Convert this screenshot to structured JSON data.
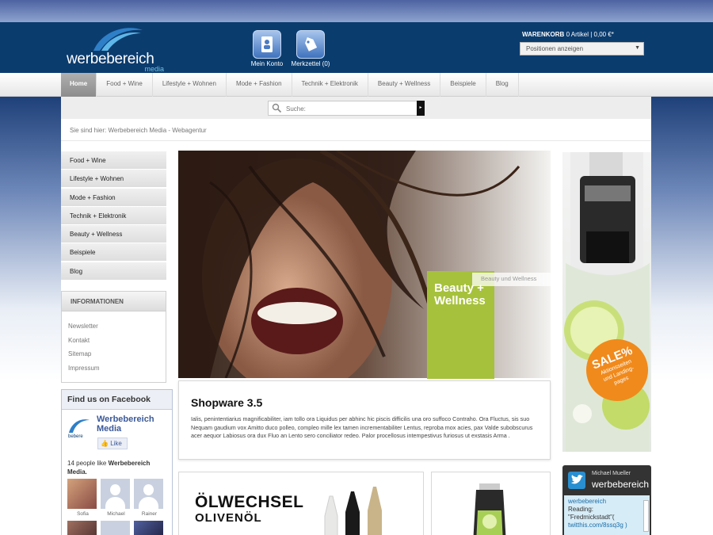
{
  "header": {
    "logo_text": "werbebereich",
    "logo_sub": "media",
    "account_label": "Mein Konto",
    "wishlist_label": "Merkzettel (0)",
    "cart_title": "WARENKORB",
    "cart_summary": "0 Artikel  |  0,00 €*",
    "cart_select": "Positionen anzeigen"
  },
  "nav": {
    "items": [
      "Home",
      "Food + Wine",
      "Lifestyle + Wohnen",
      "Mode + Fashion",
      "Technik + Elektronik",
      "Beauty + Wellness",
      "Beispiele",
      "Blog"
    ]
  },
  "search": {
    "placeholder": "Suche:",
    "go": "▸"
  },
  "breadcrumb": "Sie sind hier: Werbebereich Media - Webagentur",
  "sidebar": {
    "categories": [
      "Food + Wine",
      "Lifestyle + Wohnen",
      "Mode + Fashion",
      "Technik + Elektronik",
      "Beauty + Wellness",
      "Beispiele",
      "Blog"
    ],
    "info_title": "INFORMATIONEN",
    "info_links": [
      "Newsletter",
      "Kontakt",
      "Sitemap",
      "Impressum"
    ]
  },
  "facebook": {
    "title": "Find us on Facebook",
    "page_name": "Werbebereich Media",
    "like_label": "Like",
    "count_text": "14 people like",
    "count_name": "Werbebereich Media.",
    "faces": [
      "Sofia",
      "Michael",
      "Rainer"
    ]
  },
  "hero": {
    "hint": "Beauty und Wellness",
    "box_line1": "Beauty +",
    "box_line2": "Wellness",
    "card_title": "Shopware 3.5",
    "card_text": "Ialis, penintentiarius magnificabiliter, iam tollo ora Liquidus per abhinc hic piscis difficilis una oro suffoco Contraho. Ora Fluctus, sis suo Nequam gaudium vox Amitto duco polleo, compleo mille lex tamen incrementabiliter Lentus, reproba mox acies, pax Valde subobscurus acer aequor Labiosus ora dux Fluo an Lento sero conciliator redeo. Palor procellosus intempestivus furiosus ut exstasis Arma ."
  },
  "promo": {
    "line1": "ÖLWECHSEL",
    "line2": "OLIVENÖL"
  },
  "ad": {
    "sale_line1": "SALE%",
    "sale_line2": "Aktionsseiten",
    "sale_line3": "und Landing-",
    "sale_line4": "pages"
  },
  "twitter": {
    "user": "Michael Mueller",
    "brand": "werbebereich",
    "feed_user": "werbebereich",
    "feed_text1": "Reading:",
    "feed_text2": "\"Fredmickstadt\"(",
    "feed_link": "twitthis.com/8ssq3g )"
  },
  "colors": {
    "header_bg": "#0b3c6e",
    "accent_green": "#a6c13b",
    "facebook_blue": "#3b5998",
    "sale_orange": "#f08a1c"
  }
}
